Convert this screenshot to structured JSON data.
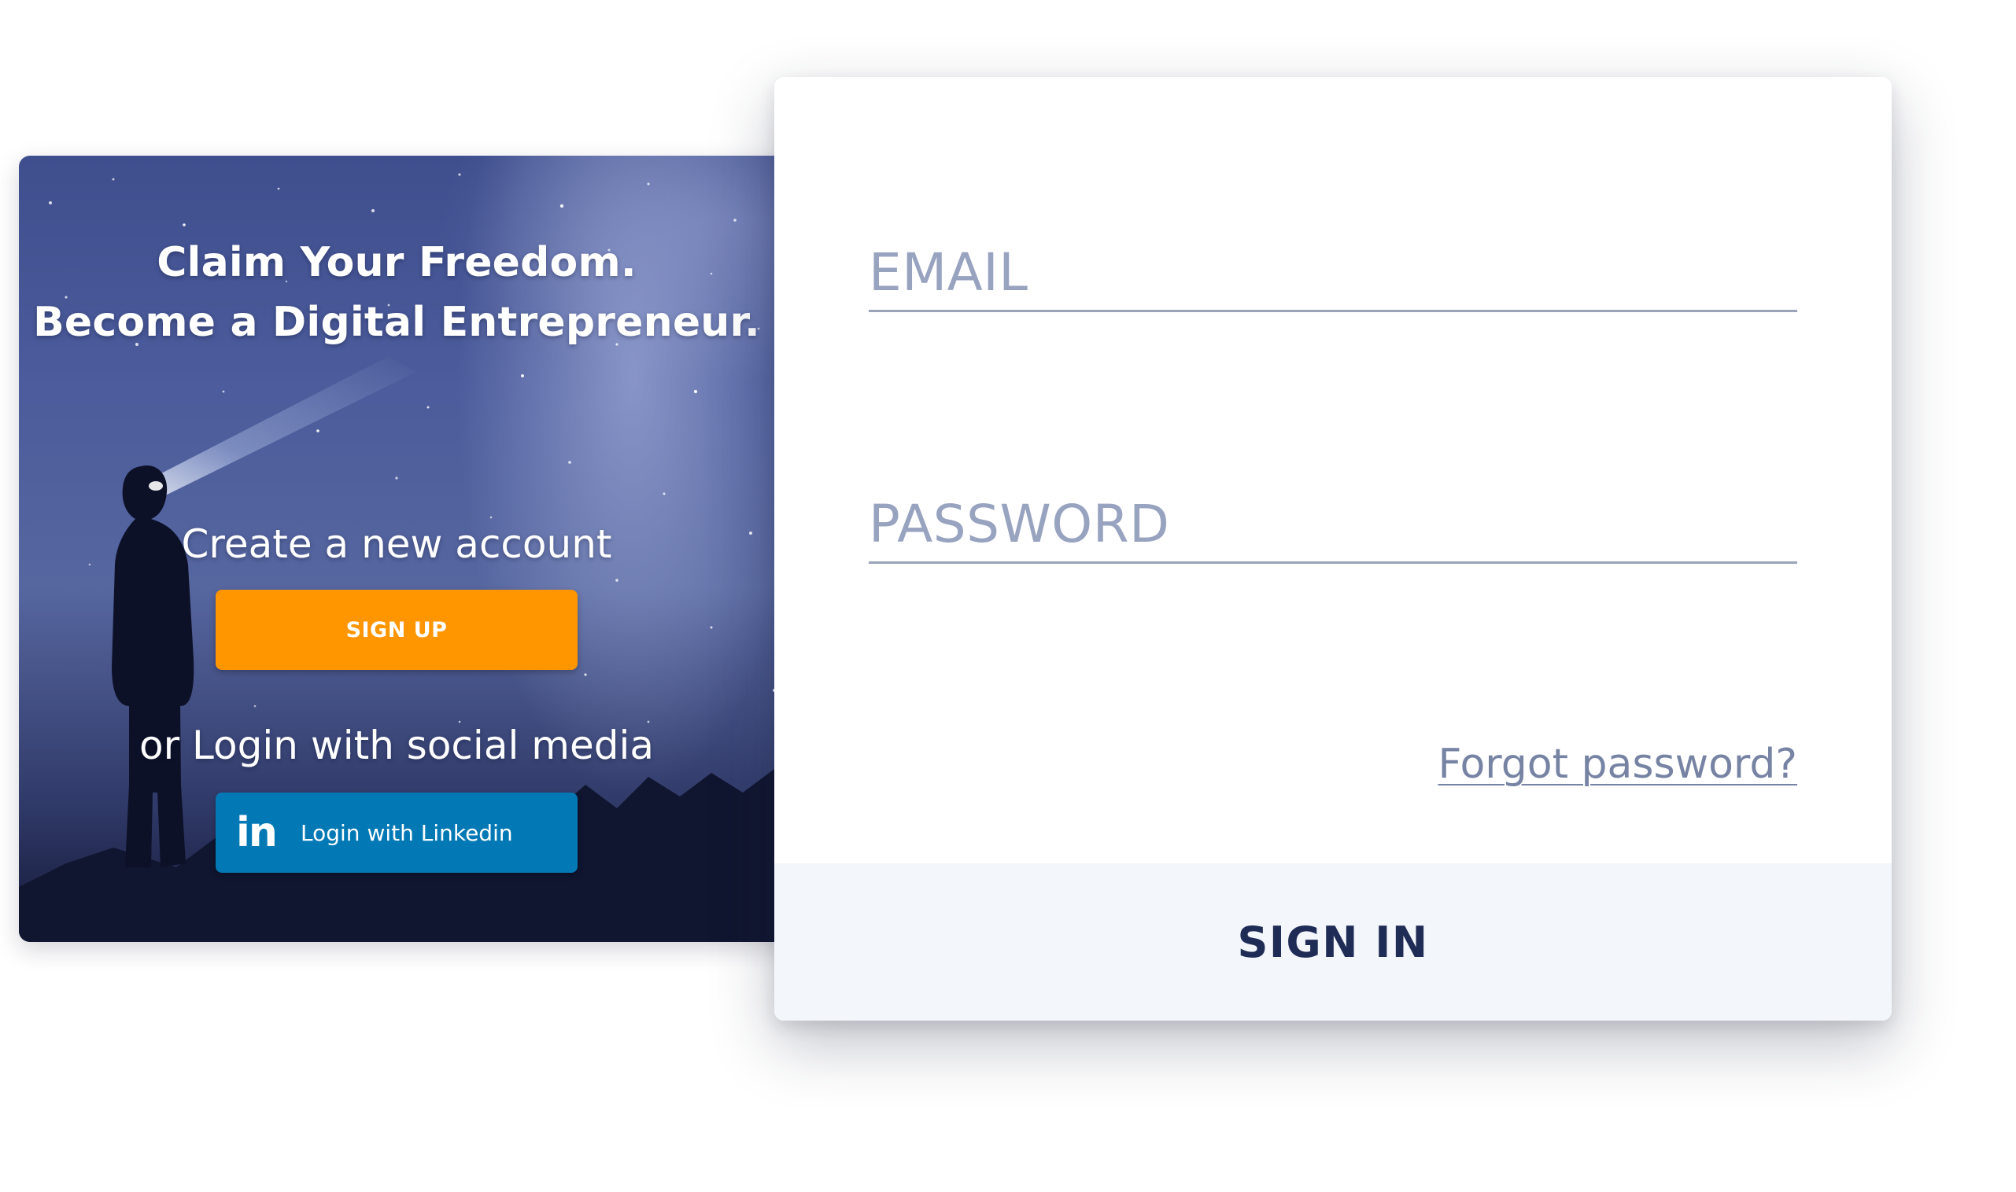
{
  "hero": {
    "title_line1": "Claim Your Freedom.",
    "title_line2": "Become a Digital Entrepreneur.",
    "create_label": "Create a new account",
    "signup_label": "SIGN UP",
    "social_label": "or Login with social media",
    "linkedin_label": "Login with Linkedin",
    "linkedin_icon": "in"
  },
  "signin": {
    "email_placeholder": "EMAIL",
    "password_placeholder": "PASSWORD",
    "forgot_label": "Forgot password?",
    "button_label": "SIGN IN"
  },
  "colors": {
    "signup": "#ff9600",
    "linkedin": "#0279b5",
    "signin_text": "#1f2c55",
    "signin_bg": "#f3f6fb",
    "placeholder": "#98a3c0"
  },
  "icons": [
    "linkedin-icon"
  ]
}
